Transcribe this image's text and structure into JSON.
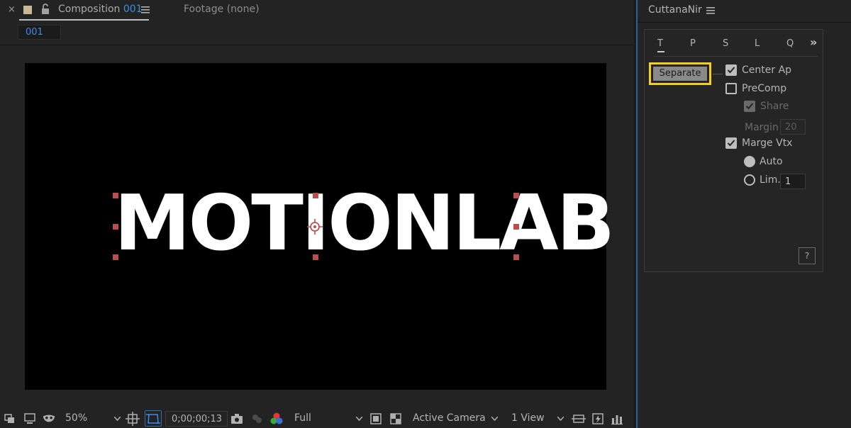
{
  "comp_tab": {
    "close_glyph": "×",
    "title_prefix": "Composition",
    "title_number": "001",
    "footage_label": "Footage",
    "footage_value": "(none)",
    "color_swatch": "#c8b896"
  },
  "breadcrumb": {
    "label": "001"
  },
  "viewer": {
    "text": "MOTIONLAB",
    "background": "#000000",
    "text_color": "#ffffff",
    "handle_color": "#b84e4e"
  },
  "toolbar": {
    "zoom": "50%",
    "timecode": "0;00;00;13",
    "resolution": "Full",
    "camera": "Active Camera",
    "views": "1 View",
    "active_color": "#2f6db8"
  },
  "side_panel": {
    "title": "CuttanaNir",
    "tabs": [
      {
        "label": "T",
        "active": true
      },
      {
        "label": "P",
        "active": false
      },
      {
        "label": "S",
        "active": false
      },
      {
        "label": "L",
        "active": false
      },
      {
        "label": "Q",
        "active": false
      }
    ],
    "more_glyph": "»",
    "separate_button": "Separate",
    "highlight_color": "#f2d11a",
    "options": {
      "center_ap": {
        "label": "Center Ap",
        "checked": true
      },
      "precomp": {
        "label": "PreComp",
        "checked": false
      },
      "share": {
        "label": "Share",
        "checked": true,
        "disabled": true
      },
      "margin": {
        "label": "Margin",
        "value": "20",
        "disabled": true
      },
      "marge_vtx": {
        "label": "Marge Vtx",
        "checked": true
      },
      "auto": {
        "label": "Auto",
        "selected": true
      },
      "lim": {
        "label": "Lim.",
        "selected": false,
        "value": "1"
      }
    },
    "help_label": "?"
  }
}
